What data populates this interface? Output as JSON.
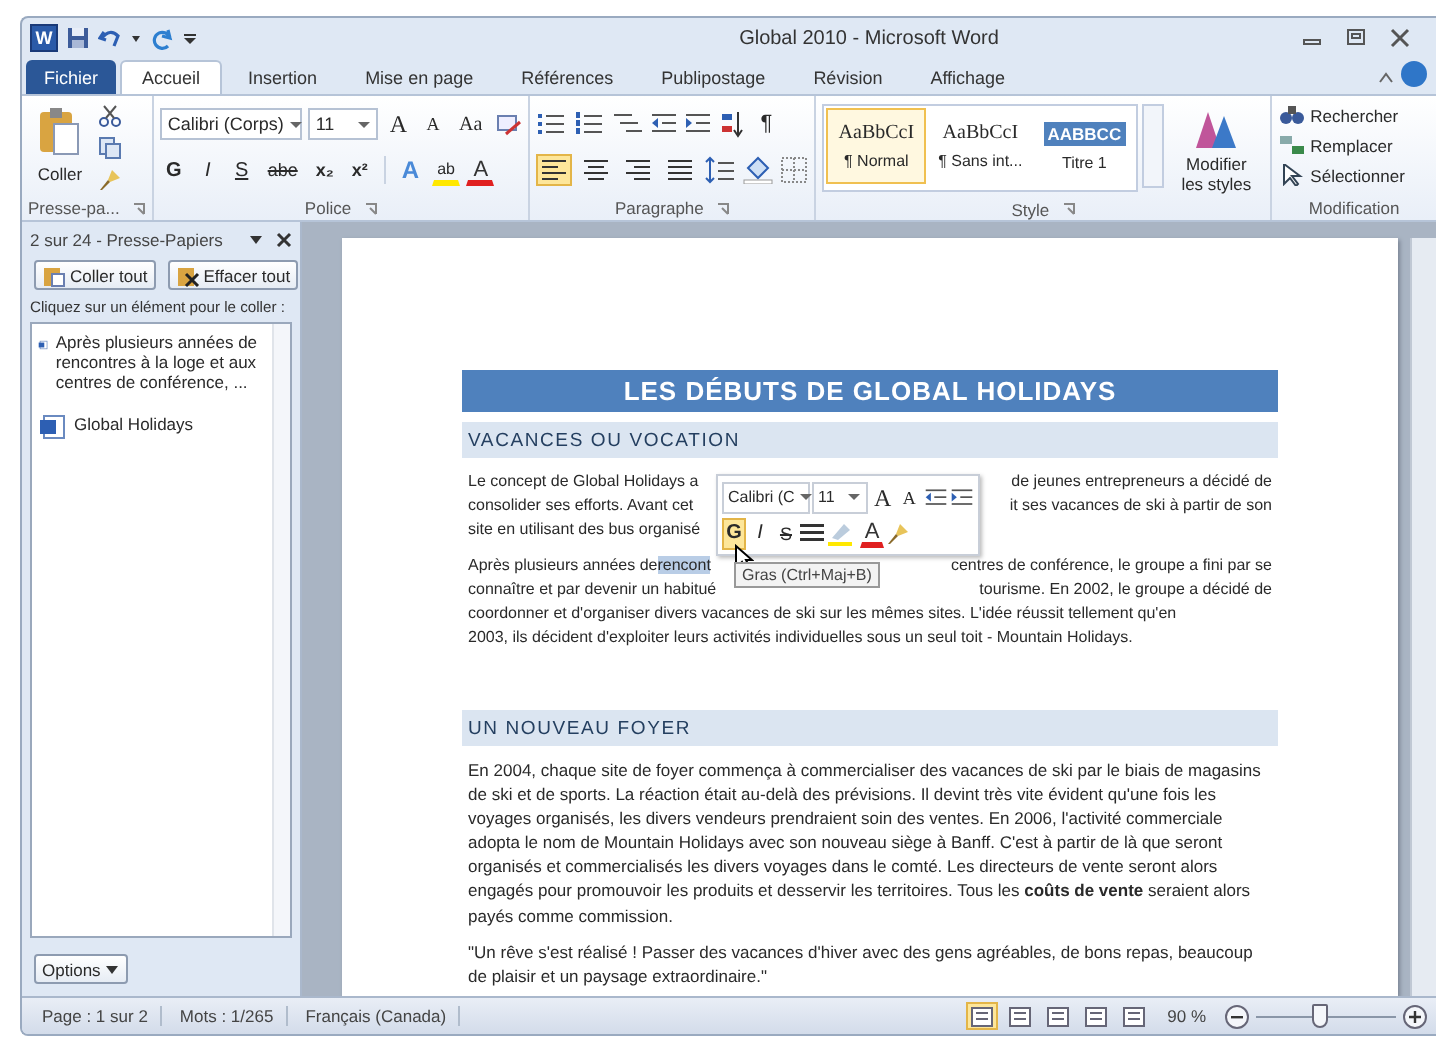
{
  "window": {
    "app_letter": "W",
    "title": "Global 2010 - Microsoft Word"
  },
  "tabs": [
    {
      "label": "Fichier",
      "kind": "file",
      "selected": false
    },
    {
      "label": "Accueil",
      "kind": "tab",
      "selected": true
    },
    {
      "label": "Insertion",
      "kind": "tab",
      "selected": false
    },
    {
      "label": "Mise en page",
      "kind": "tab",
      "selected": false
    },
    {
      "label": "Références",
      "kind": "tab",
      "selected": false
    },
    {
      "label": "Publipostage",
      "kind": "tab",
      "selected": false
    },
    {
      "label": "Révision",
      "kind": "tab",
      "selected": false
    },
    {
      "label": "Affichage",
      "kind": "tab",
      "selected": false
    }
  ],
  "ribbon": {
    "clipboard": {
      "paste": "Coller",
      "label": "Presse-pa..."
    },
    "font": {
      "name": "Calibri (Corps)",
      "size": "11",
      "label": "Police",
      "tools": [
        {
          "kind": "grow",
          "label": "A"
        },
        {
          "kind": "shrink",
          "label": "A"
        },
        {
          "kind": "case",
          "label": "Aa"
        }
      ],
      "format": [
        {
          "kind": "bold",
          "label": "G"
        },
        {
          "kind": "italic",
          "label": "I"
        },
        {
          "kind": "underline",
          "label": "S"
        },
        {
          "kind": "strike",
          "label": "abe"
        },
        {
          "kind": "sub",
          "label": "x₂"
        },
        {
          "kind": "sup",
          "label": "x²"
        }
      ],
      "effects": [
        {
          "kind": "effects",
          "label": "A"
        },
        {
          "kind": "highlight",
          "label": "ab"
        },
        {
          "kind": "color",
          "label": "A"
        }
      ]
    },
    "paragraph": {
      "label": "Paragraphe",
      "marks": "¶",
      "alignments": [
        {
          "selected": true
        },
        {
          "selected": false
        },
        {
          "selected": false
        },
        {
          "selected": false
        }
      ]
    },
    "styles": {
      "label": "Style",
      "change": "Modifier les styles",
      "items": [
        {
          "sample": "AaBbCcI",
          "name": "¶ Normal",
          "kind": "body",
          "selected": true
        },
        {
          "sample": "AaBbCcI",
          "name": "¶ Sans int...",
          "kind": "body",
          "selected": false
        },
        {
          "sample": "AABBCC",
          "name": "Titre 1",
          "kind": "heading",
          "selected": false
        }
      ]
    },
    "editing": {
      "label": "Modification",
      "items": [
        {
          "kind": "find",
          "label": "Rechercher"
        },
        {
          "kind": "replace",
          "label": "Remplacer"
        },
        {
          "kind": "select",
          "label": "Sélectionner"
        }
      ]
    }
  },
  "clipboard_pane": {
    "title": "2 sur 24 - Presse-Papiers",
    "buttons": [
      {
        "kind": "paste",
        "label": "Coller tout"
      },
      {
        "kind": "clear",
        "label": "Effacer tout"
      }
    ],
    "hint": "Cliquez sur un élément pour le coller :",
    "items": [
      "Après plusieurs années de rencontres à la loge et aux centres de conférence, ...",
      "Global Holidays"
    ],
    "options": "Options"
  },
  "document": {
    "title": "LES DÉBUTS DE GLOBAL HOLIDAYS",
    "sections": [
      {
        "heading": "VACANCES OU VOCATION",
        "kind": "lines",
        "paragraphs": [
          [
            {
              "left": "Le concept de Global Holidays a",
              "right": "de jeunes entrepreneurs a décidé de"
            },
            {
              "left": "consolider ses efforts. Avant cet",
              "right": "it ses vacances de ski à partir de son"
            },
            {
              "left": "site en utilisant des bus organisé"
            }
          ],
          [
            {
              "left": "Après plusieurs années de",
              "selection": "rencont",
              "right": "centres de conférence, le groupe a fini par se"
            },
            {
              "left": "connaître et par devenir un habitué",
              "right": "tourisme.  En 2002, le groupe a décidé de"
            },
            {
              "left": "coordonner et d'organiser divers vacances de ski  sur les mêmes sites.   L'idée réussit tellement qu'en"
            },
            {
              "left": "2003, ils décident d'exploiter leurs activités individuelles sous un seul toit - Mountain Holidays."
            }
          ]
        ]
      },
      {
        "heading": "UN NOUVEAU FOYER",
        "kind": "paragraphs",
        "paragraphs": [
          "En 2004, chaque site de foyer commença à commercialiser des vacances de ski par le biais de magasins de ski  et de sports. La réaction était au-delà des prévisions. Il devint très vite évident qu'une fois les voyages organisés, les divers vendeurs prendraient soin des ventes.  En 2006, l'activité commerciale adopta le nom de Mountain Holidays avec son nouveau siège à Banff.   C'est à partir de là que seront organisés et commercialisés les divers voyages dans le comté.   Les directeurs de vente seront alors engagés pour promouvoir les produits et desservir les territoires.  Tous les **coûts de vente** seraient alors payés comme commission.",
          " \"Un rêve s'est réalisé ! Passer des vacances d'hiver avec des gens agréables, de bons repas, beaucoup de plaisir et un paysage extraordinaire.\""
        ]
      }
    ]
  },
  "mini_toolbar": {
    "font": "Calibri (C",
    "size": "11",
    "tools": [
      {
        "kind": "grow",
        "label": "A"
      },
      {
        "kind": "shrink",
        "label": "A"
      }
    ],
    "buttons": [
      {
        "kind": "bold",
        "label": "G",
        "selected": true
      },
      {
        "kind": "italic",
        "label": "I",
        "selected": false
      },
      {
        "kind": "strike",
        "label": "S",
        "selected": false
      }
    ],
    "color_label": "A",
    "tooltip": "Gras (Ctrl+Maj+B)"
  },
  "status_bar": {
    "page": "Page : 1 sur 2",
    "words": "Mots : 1/265",
    "language": "Français (Canada)",
    "views": [
      {
        "selected": true
      },
      {
        "selected": false
      },
      {
        "selected": false
      },
      {
        "selected": false
      },
      {
        "selected": false
      }
    ],
    "zoom": "90 %",
    "zoom_slider": {
      "level": 0.45
    }
  }
}
